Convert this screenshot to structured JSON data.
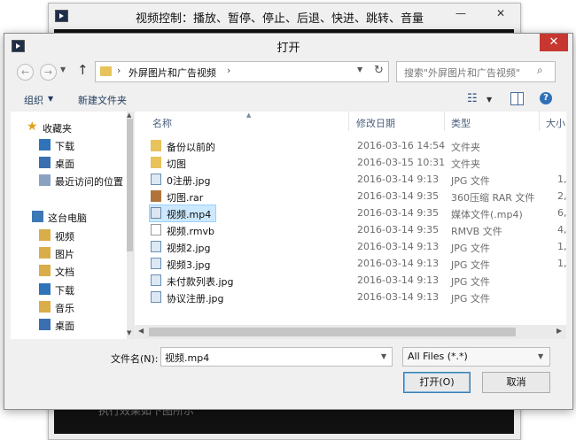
{
  "background_window": {
    "title": "视频控制：播放、暂停、停止、后退、快进、跳转、音量",
    "min_label": "—",
    "close_label": "✕",
    "footer_text": "执行效果如下图所示"
  },
  "dialog": {
    "title": "打开",
    "close_label": "✕",
    "address": {
      "path": "外屏图片和广告视频",
      "separator": "›"
    },
    "search": {
      "placeholder": "搜索\"外屏图片和广告视频\"",
      "icon": "search-icon"
    },
    "toolbar": {
      "organize": "组织",
      "new_folder": "新建文件夹"
    },
    "nav": {
      "favorites": "收藏夹",
      "favorite_items": [
        "下载",
        "桌面",
        "最近访问的位置"
      ],
      "this_pc": "这台电脑",
      "pc_items": [
        "视频",
        "图片",
        "文档",
        "下载",
        "音乐",
        "桌面"
      ]
    },
    "columns": {
      "name": "名称",
      "date": "修改日期",
      "type": "类型",
      "size": "大小"
    },
    "files": [
      {
        "name": "备份以前的",
        "date": "2016-03-16 14:54",
        "type": "文件夹",
        "size": "",
        "icon": "folder-icon"
      },
      {
        "name": "切图",
        "date": "2016-03-15 10:31",
        "type": "文件夹",
        "size": "",
        "icon": "folder-icon"
      },
      {
        "name": "0注册.jpg",
        "date": "2016-03-14 9:13",
        "type": "JPG 文件",
        "size": "1,",
        "icon": "image-file-icon"
      },
      {
        "name": "切图.rar",
        "date": "2016-03-14 9:35",
        "type": "360压缩 RAR 文件",
        "size": "2,",
        "icon": "archive-file-icon"
      },
      {
        "name": "视频.mp4",
        "date": "2016-03-14 9:35",
        "type": "媒体文件(.mp4)",
        "size": "6,",
        "icon": "video-file-icon",
        "selected": true
      },
      {
        "name": "视频.rmvb",
        "date": "2016-03-14 9:35",
        "type": "RMVB 文件",
        "size": "4,",
        "icon": "video-file-icon"
      },
      {
        "name": "视频2.jpg",
        "date": "2016-03-14 9:13",
        "type": "JPG 文件",
        "size": "1,",
        "icon": "image-file-icon"
      },
      {
        "name": "视频3.jpg",
        "date": "2016-03-14 9:13",
        "type": "JPG 文件",
        "size": "1,",
        "icon": "image-file-icon"
      },
      {
        "name": "未付款列表.jpg",
        "date": "2016-03-14 9:13",
        "type": "JPG 文件",
        "size": "",
        "icon": "image-file-icon"
      },
      {
        "name": "协议注册.jpg",
        "date": "2016-03-14 9:13",
        "type": "JPG 文件",
        "size": "",
        "icon": "image-file-icon"
      }
    ],
    "filename_label": "文件名(N):",
    "filename_value": "视频.mp4",
    "filter_value": "All Files (*.*)",
    "open_button": "打开(O)",
    "cancel_button": "取消"
  },
  "colors": {
    "close_red": "#c7372f",
    "selection": "#cce8ff",
    "link_blue": "#1e395b"
  }
}
